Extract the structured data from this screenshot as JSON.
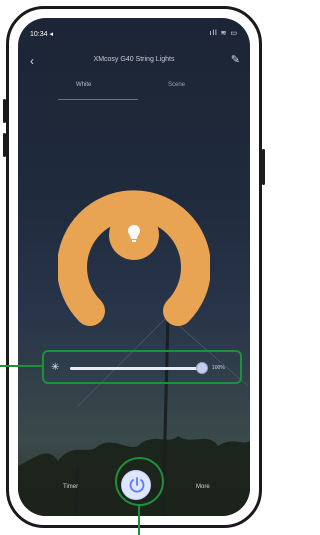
{
  "status_bar": {
    "time": "10:34 ◂",
    "icons": "ıll ≋ ▭"
  },
  "header": {
    "back_icon": "chevron-left-icon",
    "title": "XMcosy G40 String Lights",
    "edit_icon": "pencil-icon"
  },
  "tabs": [
    {
      "label": "White",
      "active": true
    },
    {
      "label": "Scene",
      "active": false
    }
  ],
  "dial": {
    "color": "#e8a353",
    "icon": "bulb-icon"
  },
  "brightness": {
    "value": "100%",
    "fraction": 1.0,
    "icon": "sun-icon"
  },
  "bottom_bar": {
    "timer_label": "Timer",
    "more_label": "More",
    "power_icon": "power-icon"
  },
  "callout_color": "#1e8f3a"
}
